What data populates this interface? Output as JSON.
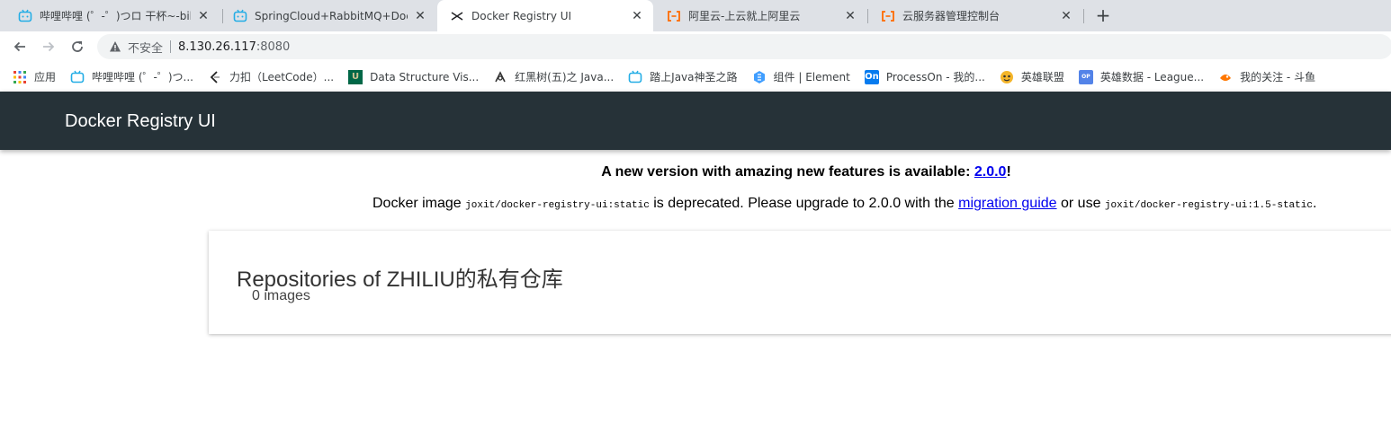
{
  "browser": {
    "tabs": [
      {
        "title": "哔哩哔哩 (゜-゜)つロ 干杯~-bilibili",
        "icon": "bilibili-icon",
        "active": false
      },
      {
        "title": "SpringCloud+RabbitMQ+Docker",
        "icon": "bilibili-icon",
        "active": false
      },
      {
        "title": "Docker Registry UI",
        "icon": "docker-registry-icon",
        "active": true
      },
      {
        "title": "阿里云-上云就上阿里云",
        "icon": "aliyun-icon",
        "active": false
      },
      {
        "title": "云服务器管理控制台",
        "icon": "aliyun-icon",
        "active": false
      }
    ],
    "new_tab_label": "+",
    "close_label": "✕",
    "address": {
      "security_text": "不安全",
      "host": "8.130.26.117",
      "port": ":8080"
    },
    "bookmarks": [
      {
        "label": "应用",
        "icon": "apps-grid-icon"
      },
      {
        "label": "哔哩哔哩 (゜-゜)つ...",
        "icon": "bilibili-icon"
      },
      {
        "label": "力扣（LeetCode）...",
        "icon": "leetcode-icon"
      },
      {
        "label": "Data Structure Vis...",
        "icon": "usf-icon"
      },
      {
        "label": "红黑树(五)之 Java...",
        "icon": "cnblogs-icon"
      },
      {
        "label": "踏上Java神圣之路",
        "icon": "bilibili-icon"
      },
      {
        "label": "组件 | Element",
        "icon": "element-icon"
      },
      {
        "label": "ProcessOn - 我的...",
        "icon": "processon-icon"
      },
      {
        "label": "英雄联盟",
        "icon": "lol-icon"
      },
      {
        "label": "英雄数据 - League...",
        "icon": "opgg-icon"
      },
      {
        "label": "我的关注 - 斗鱼",
        "icon": "douyu-icon"
      }
    ]
  },
  "app": {
    "title": "Docker Registry UI",
    "notice": {
      "headline": "A new version with amazing new features is available: ",
      "version_link": "2.0.0",
      "headline_end": "!",
      "line_prefix": "Docker image ",
      "deprecated_image": "joxit/docker-registry-ui:static",
      "line_mid": " is deprecated. Please upgrade to 2.0.0 with the ",
      "migration_link": "migration guide",
      "line_or": " or use ",
      "alt_image": "joxit/docker-registry-ui:1.5-static",
      "line_end": "."
    },
    "repositories": {
      "title": "Repositories of ZHILIU的私有仓库",
      "count": "0 images"
    }
  },
  "colors": {
    "header_bg": "#263238",
    "link": "#0000ee",
    "tabstrip_bg": "#dee1e6"
  }
}
